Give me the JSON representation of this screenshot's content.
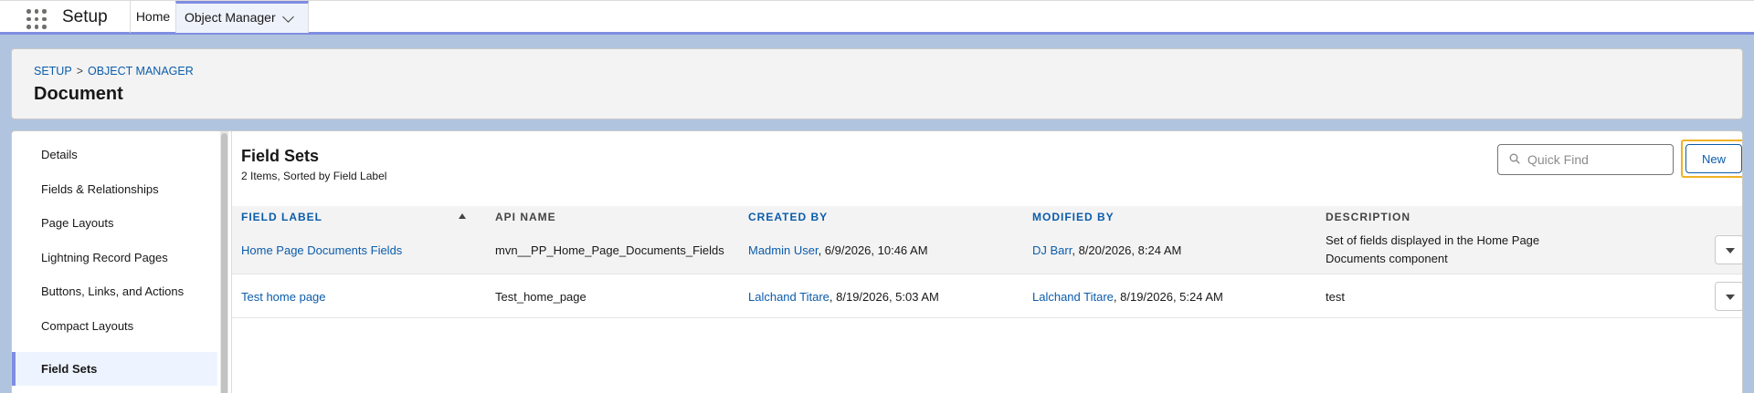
{
  "app": {
    "name": "Setup"
  },
  "tabs": [
    {
      "label": "Home"
    },
    {
      "label": "Object Manager"
    }
  ],
  "breadcrumb": {
    "root": "SETUP",
    "separator": ">",
    "current": "OBJECT MANAGER"
  },
  "page": {
    "title": "Document"
  },
  "sidebar": {
    "items": [
      {
        "label": "Details"
      },
      {
        "label": "Fields & Relationships"
      },
      {
        "label": "Page Layouts"
      },
      {
        "label": "Lightning Record Pages"
      },
      {
        "label": "Buttons, Links, and Actions"
      },
      {
        "label": "Compact Layouts"
      },
      {
        "label": "Field Sets"
      }
    ],
    "active": "Field Sets"
  },
  "section": {
    "title": "Field Sets",
    "subtitle": "2 Items, Sorted by Field Label",
    "search_placeholder": "Quick Find",
    "new_label": "New"
  },
  "table": {
    "columns": [
      "FIELD LABEL",
      "API NAME",
      "CREATED BY",
      "MODIFIED BY",
      "DESCRIPTION"
    ],
    "rows": [
      {
        "field_label": "Home Page Documents Fields",
        "api_name": "mvn__PP_Home_Page_Documents_Fields",
        "created_by_user": "Madmin User",
        "created_by_date": ", 6/9/2026, 10:46 AM",
        "modified_by_user": "DJ Barr",
        "modified_by_date": ", 8/20/2026, 8:24 AM",
        "description": "Set of fields displayed in the Home Page Documents component"
      },
      {
        "field_label": "Test home page",
        "api_name": "Test_home_page",
        "created_by_user": "Lalchand Titare",
        "created_by_date": ", 8/19/2026, 5:03 AM",
        "modified_by_user": "Lalchand Titare",
        "modified_by_date": ", 8/19/2026, 5:24 AM",
        "description": "test"
      }
    ]
  },
  "colors": {
    "link": "#0b5cab",
    "accent": "#7f8de1",
    "highlight": "#f0b323"
  }
}
